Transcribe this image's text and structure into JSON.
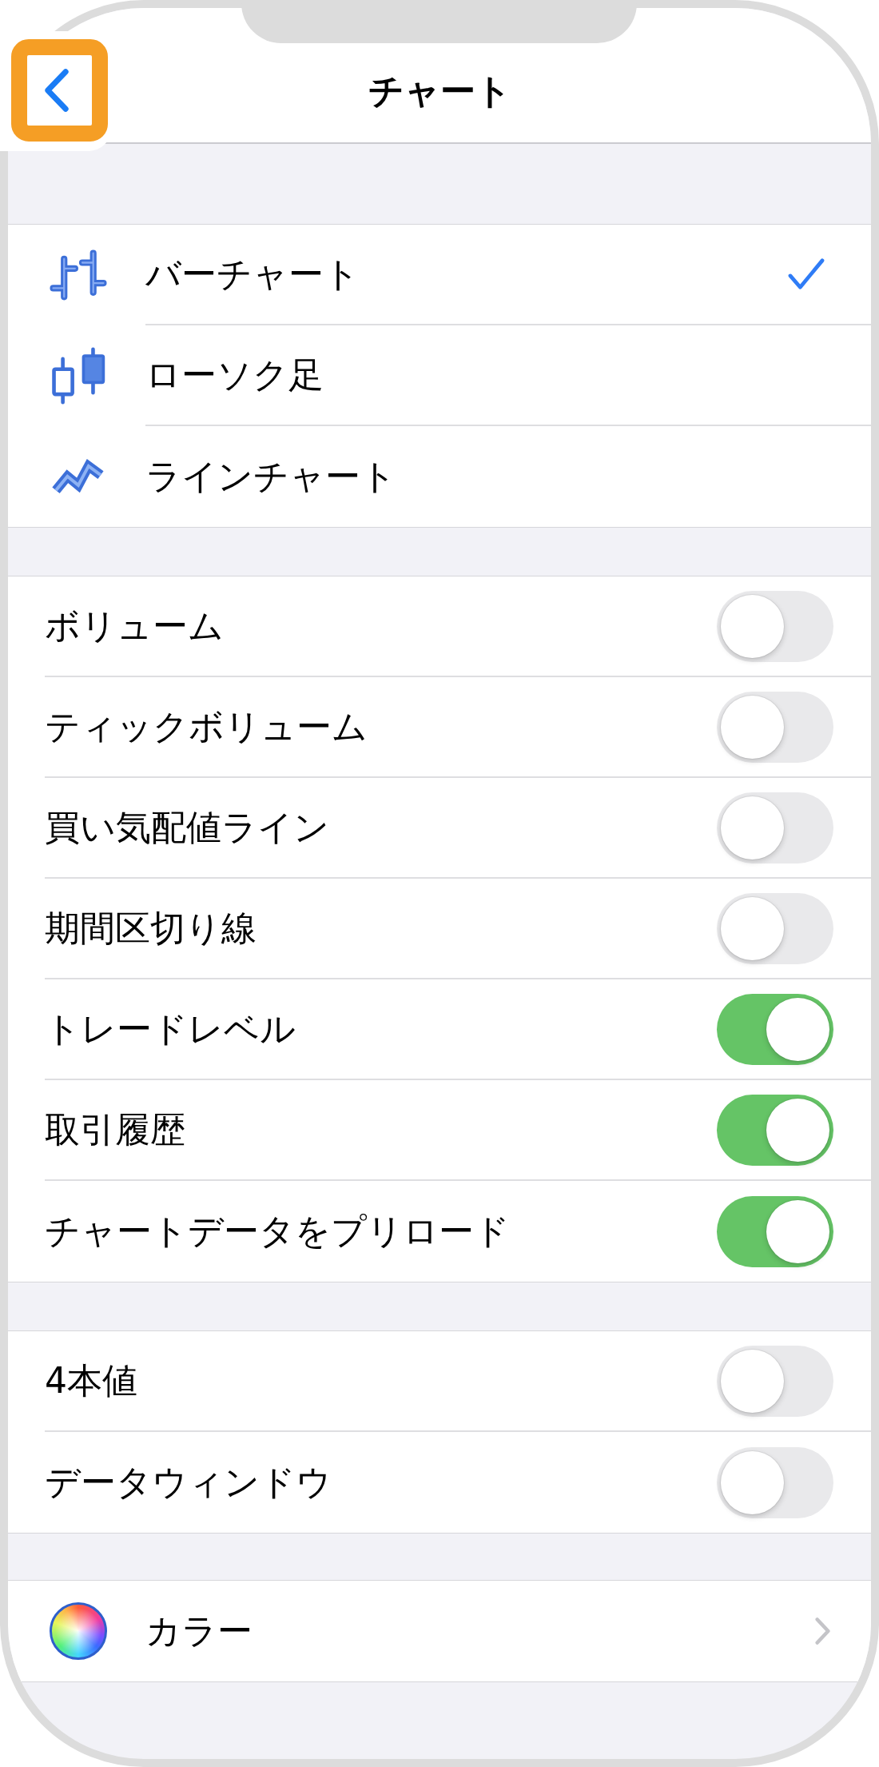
{
  "nav": {
    "title": "チャート",
    "back": {
      "highlighted": true
    }
  },
  "chart_types": [
    {
      "kind": "bar",
      "label": "バーチャート",
      "selected": true
    },
    {
      "kind": "candlestick",
      "label": "ローソク足",
      "selected": false
    },
    {
      "kind": "line",
      "label": "ラインチャート",
      "selected": false
    }
  ],
  "display_options": [
    {
      "label": "ボリューム",
      "on": false
    },
    {
      "label": "ティックボリューム",
      "on": false
    },
    {
      "label": "買い気配値ライン",
      "on": false
    },
    {
      "label": "期間区切り線",
      "on": false
    },
    {
      "label": "トレードレベル",
      "on": true
    },
    {
      "label": "取引履歴",
      "on": true
    },
    {
      "label": "チャートデータをプリロード",
      "on": true
    }
  ],
  "data_options": [
    {
      "label": "4本値",
      "on": false
    },
    {
      "label": "データウィンドウ",
      "on": false
    }
  ],
  "color_setting": {
    "label": "カラー"
  }
}
